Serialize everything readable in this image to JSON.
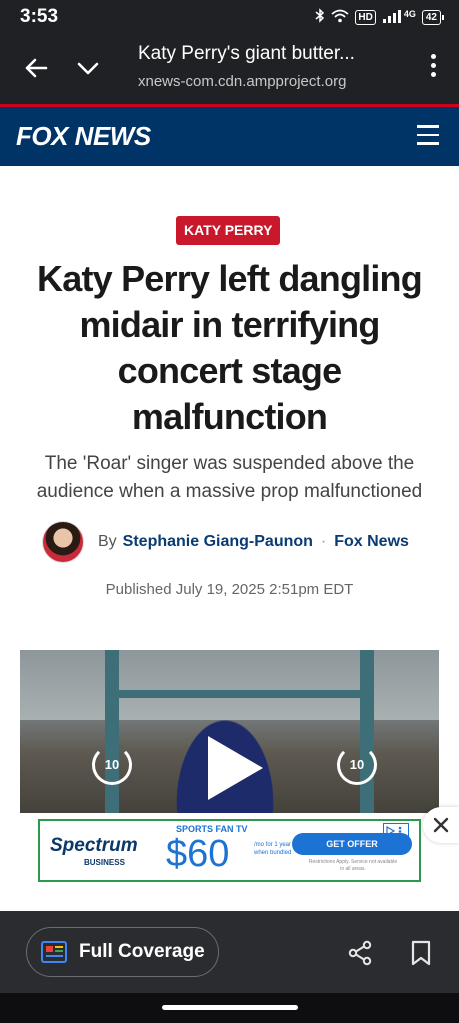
{
  "status_bar": {
    "time": "3:53",
    "hd": "HD",
    "network": "4G",
    "battery": "42"
  },
  "tab_bar": {
    "title": "Katy Perry's giant butter...",
    "url": "xnews-com.cdn.ampproject.org"
  },
  "site": {
    "logo": "FOX NEWS",
    "brand_color": "#003366"
  },
  "article": {
    "category": "KATY PERRY",
    "headline": "Katy Perry left dangling midair in terrifying concert stage malfunction",
    "subhead": "The 'Roar' singer was suspended above the audience when a massive prop malfunctioned",
    "by_label": "By",
    "author": "Stephanie Giang-Paunon",
    "separator": "·",
    "source": "Fox News",
    "published": "Published July 19, 2025 2:51pm EDT"
  },
  "video": {
    "replay_label": "10",
    "forward_label": "10"
  },
  "ad": {
    "brand": "Spectrum",
    "brand_sub": "BUSINESS",
    "headline": "SPORTS FAN TV",
    "price": "$60",
    "price_note": "/mo for 1 year when bundled",
    "cta": "GET OFFER",
    "fine_print": "Restrictions Apply. Service not available in all areas."
  },
  "bottom_bar": {
    "full_coverage_label": "Full Coverage"
  }
}
